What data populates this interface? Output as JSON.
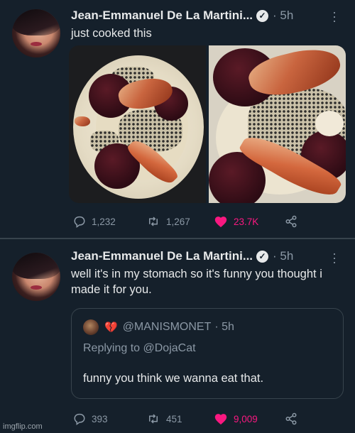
{
  "tweets": [
    {
      "author": "Jean-Emmanuel De La Martini...",
      "time": "5h",
      "text": "just cooked this",
      "stats": {
        "replies": "1,232",
        "retweets": "1,267",
        "likes": "23.7K"
      }
    },
    {
      "author": "Jean-Emmanuel De La Martini...",
      "time": "5h",
      "text": "well it's in my stomach so it's funny you thought i made it for you.",
      "quote": {
        "handle": "@MANISMONET",
        "time": "5h",
        "replying_label": "Replying to",
        "replying_to": "@DojaCat",
        "text": "funny you think we wanna eat that."
      },
      "stats": {
        "replies": "393",
        "retweets": "451",
        "likes": "9,009"
      }
    }
  ],
  "watermark": "imgflip.com",
  "colors": {
    "background": "#15202b",
    "muted": "#8b98a5",
    "like": "#f91880",
    "border": "#38444d"
  },
  "icons": [
    "verified-icon",
    "more-icon",
    "reply-icon",
    "retweet-icon",
    "heart-icon",
    "share-icon",
    "broken-heart-icon"
  ]
}
